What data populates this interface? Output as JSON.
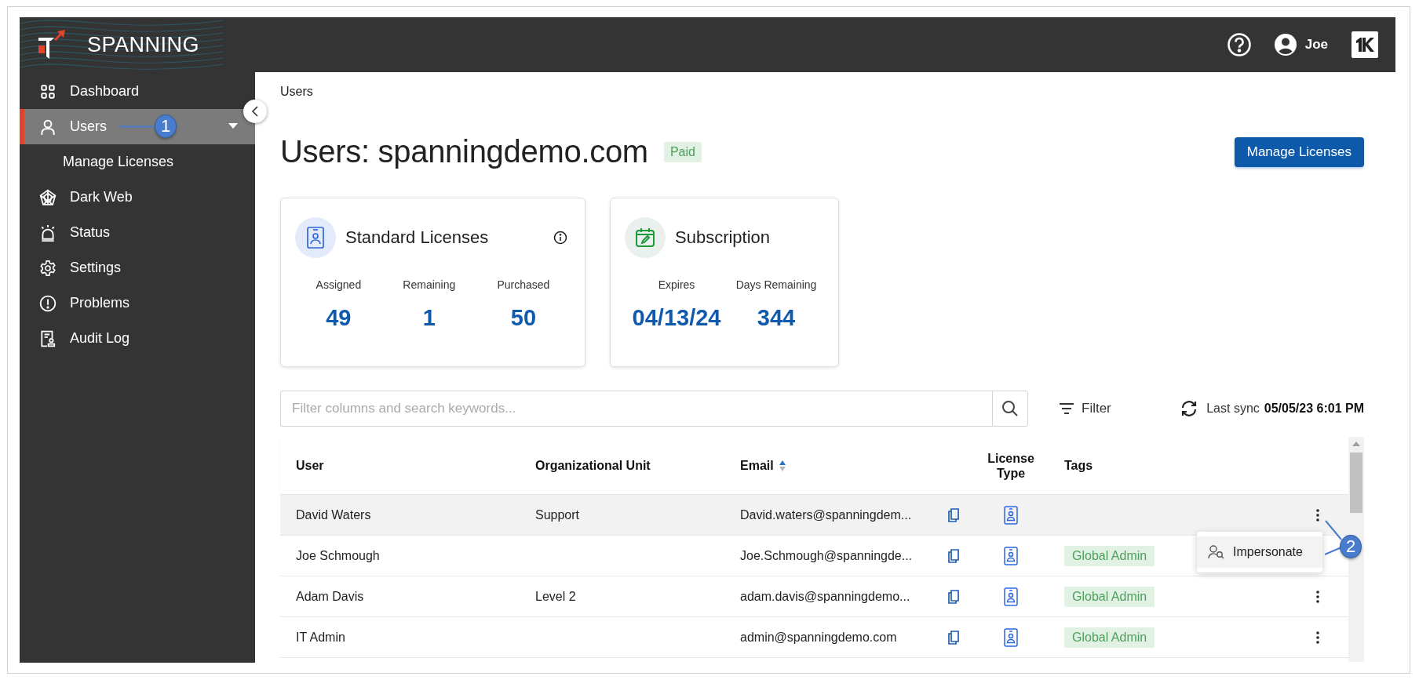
{
  "header": {
    "logo_text": "SPANNING",
    "user": "Joe"
  },
  "sidebar": {
    "items": [
      {
        "label": "Dashboard",
        "selected": false
      },
      {
        "label": "Users",
        "selected": true,
        "expanded": true,
        "children": [
          {
            "label": "Manage Licenses",
            "selected": false
          }
        ]
      },
      {
        "label": "Dark Web",
        "selected": false
      },
      {
        "label": "Status",
        "selected": false
      },
      {
        "label": "Settings",
        "selected": false
      },
      {
        "label": "Problems",
        "selected": false
      },
      {
        "label": "Audit Log",
        "selected": false
      }
    ]
  },
  "breadcrumb": "Users",
  "title": "Users: spanningdemo.com",
  "status_badge": "Paid",
  "primary_button": "Manage Licenses",
  "cards": [
    {
      "title": "Standard Licenses",
      "stats": [
        {
          "label": "Assigned",
          "value": "49"
        },
        {
          "label": "Remaining",
          "value": "1"
        },
        {
          "label": "Purchased",
          "value": "50"
        }
      ]
    },
    {
      "title": "Subscription",
      "stats": [
        {
          "label": "Expires",
          "value": "04/13/24"
        },
        {
          "label": "Days Remaining",
          "value": "344"
        }
      ]
    }
  ],
  "search": {
    "placeholder": "Filter columns and search keywords..."
  },
  "filter_button": "Filter",
  "last_sync": {
    "label": "Last sync",
    "value": "05/05/23 6:01 PM"
  },
  "table": {
    "columns": [
      {
        "label": "User",
        "sorted": false
      },
      {
        "label": "Organizational Unit",
        "sorted": false
      },
      {
        "label": "Email",
        "sorted": true
      },
      {
        "label": "License Type",
        "sorted": false
      },
      {
        "label": "Tags",
        "sorted": false
      }
    ],
    "rows": [
      {
        "user": "David Waters",
        "org_unit": "Support",
        "email": "David.waters@spanningdem...",
        "tags": [],
        "highlighted": true,
        "menu": [
          "Impersonate"
        ]
      },
      {
        "user": "Joe Schmough",
        "org_unit": "",
        "email": "Joe.Schmough@spanningde...",
        "tags": [
          "Global Admin"
        ],
        "highlighted": false
      },
      {
        "user": "Adam Davis",
        "org_unit": "Level 2",
        "email": "adam.davis@spanningdemo...",
        "tags": [
          "Global Admin"
        ],
        "highlighted": false
      },
      {
        "user": "IT Admin",
        "org_unit": "",
        "email": "admin@spanningdemo.com",
        "tags": [
          "Global Admin"
        ],
        "highlighted": false
      }
    ]
  },
  "callouts": [
    {
      "number": "1"
    },
    {
      "number": "2"
    }
  ]
}
